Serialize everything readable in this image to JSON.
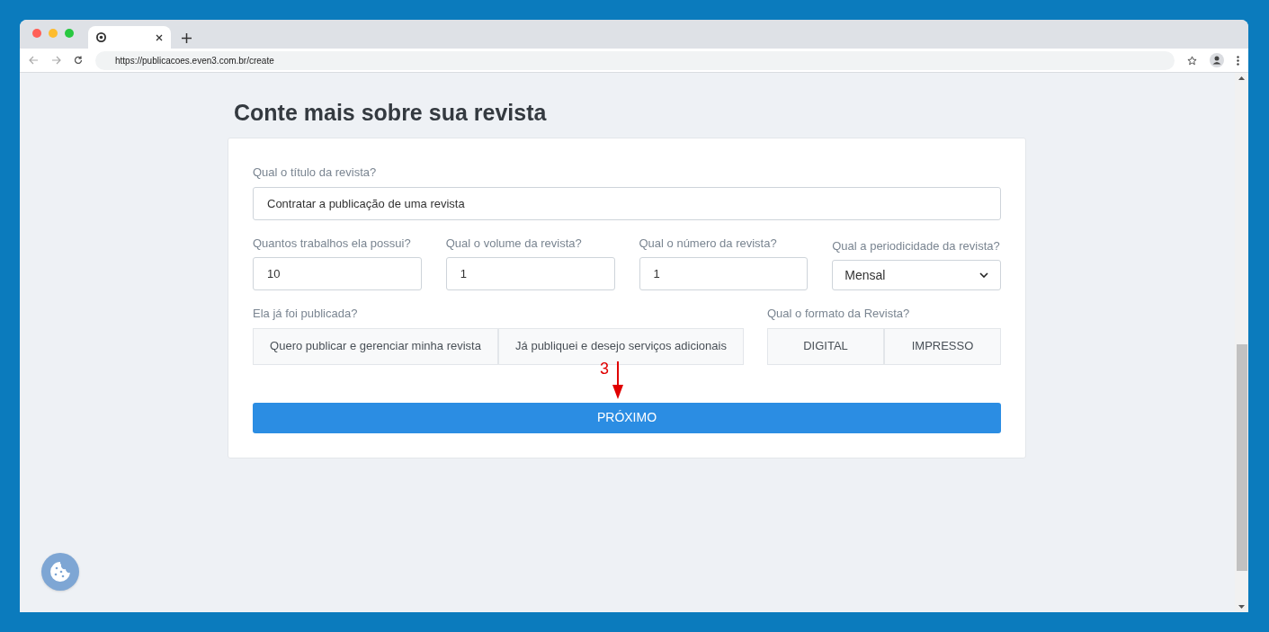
{
  "browser": {
    "url": "https://publicacoes.even3.com.br/create"
  },
  "page": {
    "title": "Conte mais sobre sua revista"
  },
  "form": {
    "title_field": {
      "label": "Qual o título da revista?",
      "value": "Contratar a publicação de uma revista"
    },
    "fields": [
      {
        "label": "Quantos trabalhos ela possui?",
        "value": "10"
      },
      {
        "label": "Qual o volume da revista?",
        "value": "1"
      },
      {
        "label": "Qual o número da revista?",
        "value": "1"
      }
    ],
    "periodicity": {
      "label": "Qual a periodicidade da revista?",
      "value": "Mensal"
    },
    "published": {
      "label": "Ela já foi publicada?",
      "options": [
        {
          "label": "Quero publicar e gerenciar minha revista",
          "selected": false
        },
        {
          "label": "Já publiquei e desejo serviços adicionais",
          "selected": false
        }
      ]
    },
    "format": {
      "label": "Qual o formato da Revista?",
      "options": [
        {
          "label": "DIGITAL",
          "selected": false
        },
        {
          "label": "IMPRESSO",
          "selected": false
        }
      ]
    },
    "submit": "PRÓXIMO"
  },
  "annotation": {
    "label": "3"
  }
}
